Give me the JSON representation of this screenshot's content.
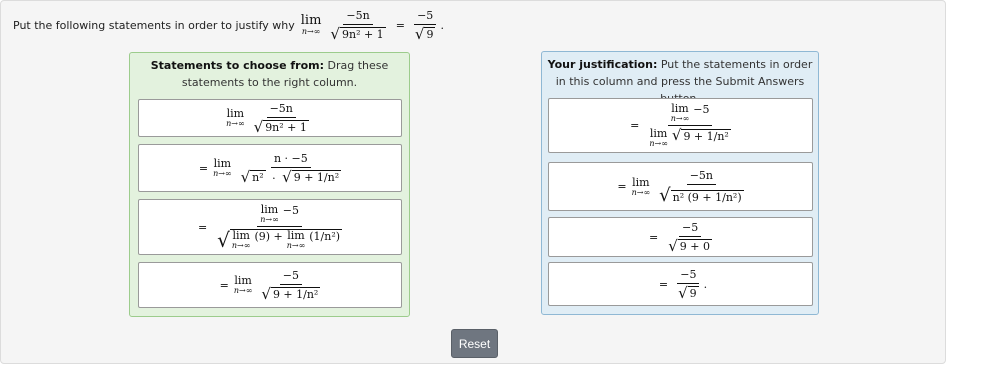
{
  "prompt": {
    "label": "Put the following statements in order to justify why",
    "lim_word": "lim",
    "lim_sub": "n→∞",
    "num": "−5n",
    "den_root": "9n² + 1",
    "eq": "=",
    "rhs_num": "−5",
    "rhs_den_root": "9",
    "period": "."
  },
  "left": {
    "heading_bold": "Statements to choose from:",
    "heading_rest": " Drag these statements to the right column.",
    "cards": [
      {
        "lim": "lim",
        "sub": "n→∞",
        "num": "−5n",
        "den_root": "9n² + 1"
      },
      {
        "prefix": "=",
        "lim": "lim",
        "sub": "n→∞",
        "num": "n · −5",
        "den_a": "n²",
        "den_dot": "·",
        "den_b": "9 + 1/n²"
      },
      {
        "prefix": "=",
        "num_lim": "lim",
        "num_sub": "n→∞",
        "num_val": "−5",
        "den_lim1": "lim",
        "den_sub1": "n→∞",
        "den_v1": "(9) +",
        "den_lim2": "lim",
        "den_sub2": "n→∞",
        "den_v2": "(1/n²)"
      },
      {
        "prefix": "=",
        "lim": "lim",
        "sub": "n→∞",
        "num": "−5",
        "den_root": "9 + 1/n²"
      }
    ]
  },
  "right": {
    "heading_bold": "Your justification:",
    "heading_rest": " Put the statements in order in this column and press the Submit Answers button.",
    "cards": [
      {
        "prefix": "=",
        "num_lim": "lim",
        "num_sub": "n→∞",
        "num_val": "−5",
        "den_lim": "lim",
        "den_sub": "n→∞",
        "den_root": "9 + 1/n²"
      },
      {
        "prefix": "=",
        "lim": "lim",
        "sub": "n→∞",
        "num": "−5n",
        "den_root": "n² (9 + 1/n²)"
      },
      {
        "prefix": "=",
        "num": "−5",
        "den_root": "9 + 0"
      },
      {
        "prefix": "=",
        "num": "−5",
        "den_root": "9",
        "suffix": "."
      }
    ]
  },
  "reset_label": "Reset"
}
